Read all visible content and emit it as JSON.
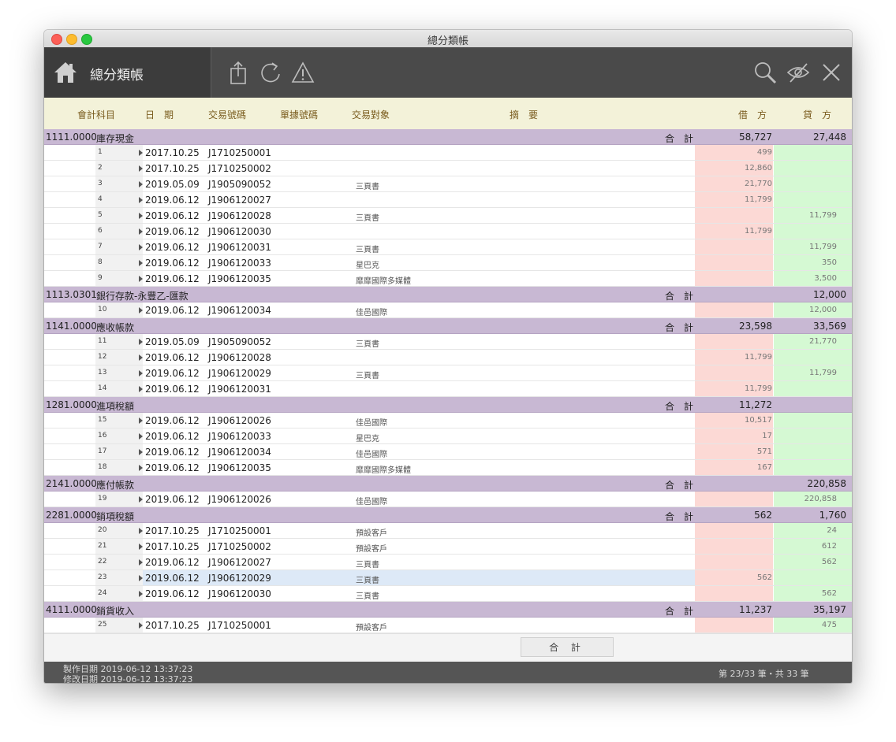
{
  "window": {
    "title": "總分類帳"
  },
  "toolbar": {
    "title": "總分類帳",
    "icons": [
      "home-icon",
      "share-icon",
      "refresh-icon",
      "warning-icon",
      "search-icon",
      "hide-icon",
      "close-icon"
    ]
  },
  "columns": {
    "account": "會計科目",
    "date": "日　期",
    "voucher": "交易號碼",
    "doc_no": "單據號碼",
    "party": "交易對象",
    "memo": "摘　要",
    "debit": "借　方",
    "credit": "貸　方"
  },
  "groups": [
    {
      "code": "1111.0000",
      "name": "庫存現金",
      "total_label": "合　計",
      "debit": "58,727",
      "credit": "27,448",
      "rows": [
        {
          "idx": "1",
          "date": "2017.10.25",
          "voucher": "J1710250001",
          "party": "",
          "debit": "499",
          "credit": ""
        },
        {
          "idx": "2",
          "date": "2017.10.25",
          "voucher": "J1710250002",
          "party": "",
          "debit": "12,860",
          "credit": ""
        },
        {
          "idx": "3",
          "date": "2019.05.09",
          "voucher": "J1905090052",
          "party": "三頁書",
          "debit": "21,770",
          "credit": ""
        },
        {
          "idx": "4",
          "date": "2019.06.12",
          "voucher": "J1906120027",
          "party": "",
          "debit": "11,799",
          "credit": ""
        },
        {
          "idx": "5",
          "date": "2019.06.12",
          "voucher": "J1906120028",
          "party": "三頁書",
          "debit": "",
          "credit": "11,799"
        },
        {
          "idx": "6",
          "date": "2019.06.12",
          "voucher": "J1906120030",
          "party": "",
          "debit": "11,799",
          "credit": ""
        },
        {
          "idx": "7",
          "date": "2019.06.12",
          "voucher": "J1906120031",
          "party": "三頁書",
          "debit": "",
          "credit": "11,799"
        },
        {
          "idx": "8",
          "date": "2019.06.12",
          "voucher": "J1906120033",
          "party": "星巴克",
          "debit": "",
          "credit": "350"
        },
        {
          "idx": "9",
          "date": "2019.06.12",
          "voucher": "J1906120035",
          "party": "靡靡國際多媒體",
          "debit": "",
          "credit": "3,500"
        }
      ]
    },
    {
      "code": "1113.0301",
      "name": "銀行存款-永豐乙-匯款",
      "total_label": "合　計",
      "debit": "",
      "credit": "12,000",
      "rows": [
        {
          "idx": "10",
          "date": "2019.06.12",
          "voucher": "J1906120034",
          "party": "佳邑國際",
          "debit": "",
          "credit": "12,000"
        }
      ]
    },
    {
      "code": "1141.0000",
      "name": "應收帳款",
      "total_label": "合　計",
      "debit": "23,598",
      "credit": "33,569",
      "rows": [
        {
          "idx": "11",
          "date": "2019.05.09",
          "voucher": "J1905090052",
          "party": "三頁書",
          "debit": "",
          "credit": "21,770"
        },
        {
          "idx": "12",
          "date": "2019.06.12",
          "voucher": "J1906120028",
          "party": "",
          "debit": "11,799",
          "credit": ""
        },
        {
          "idx": "13",
          "date": "2019.06.12",
          "voucher": "J1906120029",
          "party": "三頁書",
          "debit": "",
          "credit": "11,799"
        },
        {
          "idx": "14",
          "date": "2019.06.12",
          "voucher": "J1906120031",
          "party": "",
          "debit": "11,799",
          "credit": ""
        }
      ]
    },
    {
      "code": "1281.0000",
      "name": "進項稅額",
      "total_label": "合　計",
      "debit": "11,272",
      "credit": "",
      "rows": [
        {
          "idx": "15",
          "date": "2019.06.12",
          "voucher": "J1906120026",
          "party": "佳邑國際",
          "debit": "10,517",
          "credit": ""
        },
        {
          "idx": "16",
          "date": "2019.06.12",
          "voucher": "J1906120033",
          "party": "星巴克",
          "debit": "17",
          "credit": ""
        },
        {
          "idx": "17",
          "date": "2019.06.12",
          "voucher": "J1906120034",
          "party": "佳邑國際",
          "debit": "571",
          "credit": ""
        },
        {
          "idx": "18",
          "date": "2019.06.12",
          "voucher": "J1906120035",
          "party": "靡靡國際多媒體",
          "debit": "167",
          "credit": ""
        }
      ]
    },
    {
      "code": "2141.0000",
      "name": "應付帳款",
      "total_label": "合　計",
      "debit": "",
      "credit": "220,858",
      "rows": [
        {
          "idx": "19",
          "date": "2019.06.12",
          "voucher": "J1906120026",
          "party": "佳邑國際",
          "debit": "",
          "credit": "220,858"
        }
      ]
    },
    {
      "code": "2281.0000",
      "name": "銷項稅額",
      "total_label": "合　計",
      "debit": "562",
      "credit": "1,760",
      "rows": [
        {
          "idx": "20",
          "date": "2017.10.25",
          "voucher": "J1710250001",
          "party": "預設客戶",
          "debit": "",
          "credit": "24"
        },
        {
          "idx": "21",
          "date": "2017.10.25",
          "voucher": "J1710250002",
          "party": "預設客戶",
          "debit": "",
          "credit": "612"
        },
        {
          "idx": "22",
          "date": "2019.06.12",
          "voucher": "J1906120027",
          "party": "三頁書",
          "debit": "",
          "credit": "562"
        },
        {
          "idx": "23",
          "date": "2019.06.12",
          "voucher": "J1906120029",
          "party": "三頁書",
          "debit": "562",
          "credit": "",
          "selected": true
        },
        {
          "idx": "24",
          "date": "2019.06.12",
          "voucher": "J1906120030",
          "party": "三頁書",
          "debit": "",
          "credit": "562"
        }
      ]
    },
    {
      "code": "4111.0000",
      "name": "銷貨收入",
      "total_label": "合　計",
      "debit": "11,237",
      "credit": "35,197",
      "rows": [
        {
          "idx": "25",
          "date": "2017.10.25",
          "voucher": "J1710250001",
          "party": "預設客戶",
          "debit": "",
          "credit": "475"
        }
      ]
    }
  ],
  "total_button": "合 計",
  "footer": {
    "created": "製作日期  2019-06-12  13:37:23",
    "modified": "修改日期  2019-06-12  13:37:23",
    "record_info": "第 23/33 筆・共 33 筆"
  }
}
